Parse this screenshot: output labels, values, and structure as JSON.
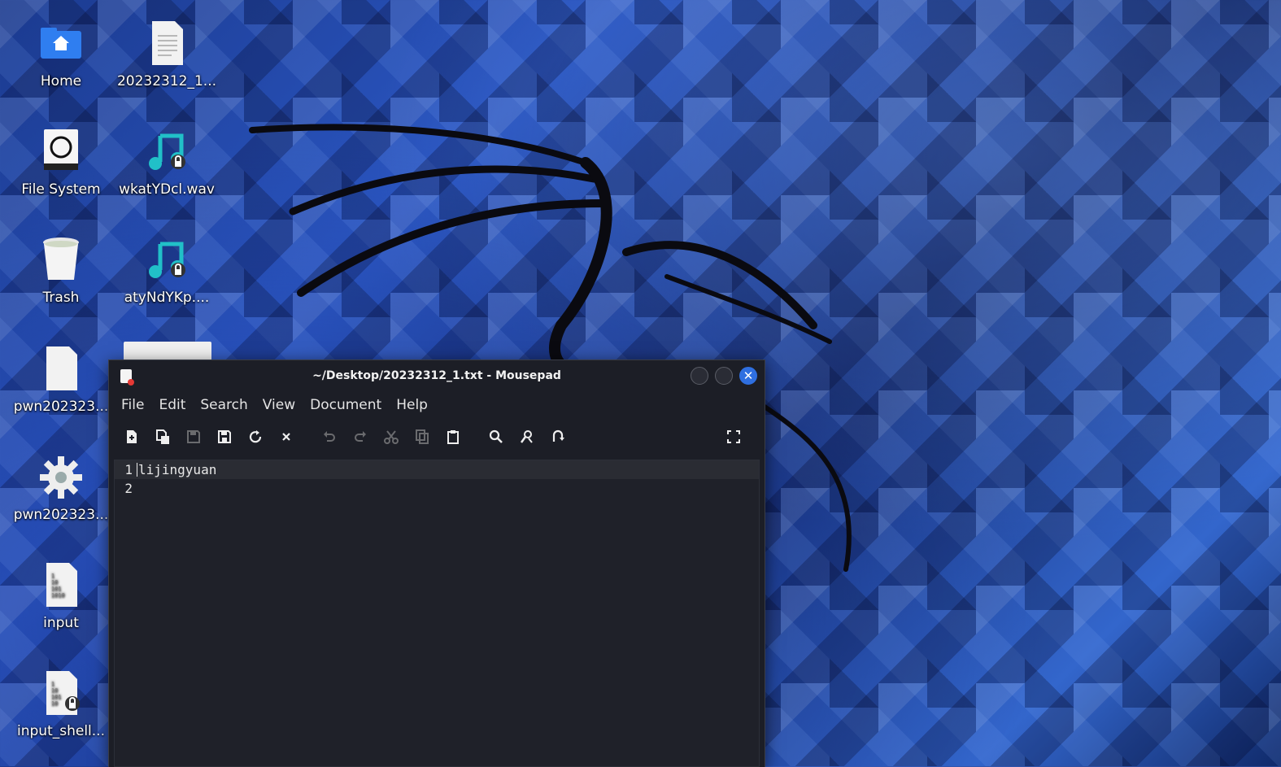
{
  "desktop": {
    "icons": [
      {
        "label": "Home",
        "icon": "home-folder-icon"
      },
      {
        "label": "20232312_1...",
        "icon": "text-file-icon"
      },
      {
        "label": "File System",
        "icon": "drive-icon"
      },
      {
        "label": "wkatYDcl.wav",
        "icon": "audio-file-locked-icon"
      },
      {
        "label": "Trash",
        "icon": "trash-icon"
      },
      {
        "label": "atyNdYKp....",
        "icon": "audio-file-locked-icon"
      },
      {
        "label": "pwn202323...",
        "icon": "blank-file-icon"
      },
      {
        "label": "pwn202323...",
        "icon": "gear-icon"
      },
      {
        "label": "input",
        "icon": "binary-file-icon"
      },
      {
        "label": "input_shell...",
        "icon": "binary-file-locked-icon"
      }
    ]
  },
  "window": {
    "title": "~/Desktop/20232312_1.txt - Mousepad",
    "menus": [
      "File",
      "Edit",
      "Search",
      "View",
      "Document",
      "Help"
    ],
    "toolbar": [
      "new-document-icon",
      "new-window-icon",
      "save-icon",
      "save-as-icon",
      "reload-icon",
      "close-document-icon",
      "undo-icon",
      "redo-icon",
      "cut-icon",
      "copy-icon",
      "paste-icon",
      "find-icon",
      "find-replace-icon",
      "goto-icon",
      "fullscreen-icon"
    ],
    "editor": {
      "lines": [
        {
          "number": "1",
          "text": "lijingyuan"
        },
        {
          "number": "2",
          "text": ""
        }
      ]
    }
  },
  "colors": {
    "accent": "#2f6fe0",
    "window_bg": "#1c1e26",
    "close_button": "#2f6fe0"
  }
}
